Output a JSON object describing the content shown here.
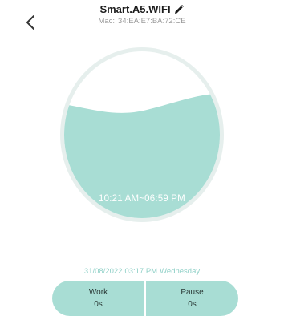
{
  "header": {
    "back_icon": "chevron-left-icon",
    "device_name": "Smart.A5.WIFI",
    "edit_icon": "pencil-icon",
    "mac_label": "Mac:",
    "mac_value": "34:EA:E7:BA:72:CE"
  },
  "schedule": {
    "time_range": "10:21 AM~06:59 PM"
  },
  "status": {
    "date": "31/08/2022",
    "time": "03:17 PM",
    "weekday": "Wednesday"
  },
  "stats": {
    "work_label": "Work",
    "work_value": "0s",
    "pause_label": "Pause",
    "pause_value": "0s"
  },
  "colors": {
    "accent": "#a8ddd4",
    "ring": "#e6efed",
    "date_text": "#8fd0c7"
  }
}
